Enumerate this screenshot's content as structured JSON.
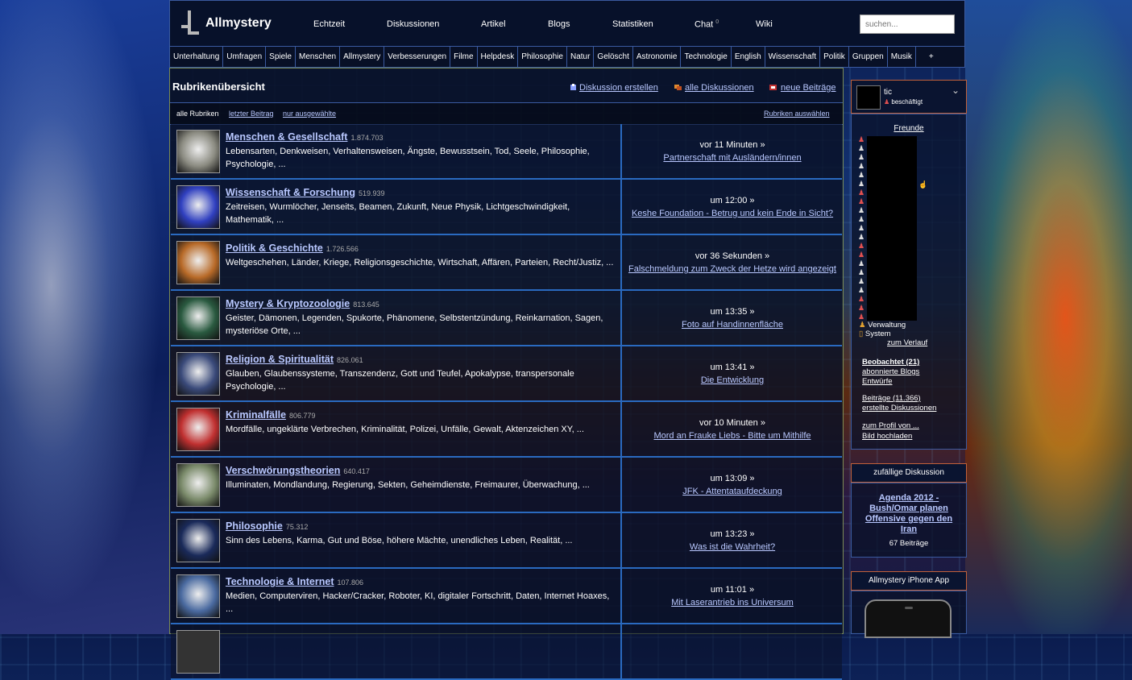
{
  "header": {
    "site_name": "Allmystery",
    "nav": [
      "Echtzeit",
      "Diskussionen",
      "Artikel",
      "Blogs",
      "Statistiken",
      "Chat",
      "Wiki"
    ],
    "chat_count": "0",
    "search_placeholder": "suchen..."
  },
  "categories": [
    "Unterhaltung",
    "Umfragen",
    "Spiele",
    "Menschen",
    "Allmystery",
    "Verbesserungen",
    "Filme",
    "Helpdesk",
    "Philosophie",
    "Natur",
    "Gelöscht",
    "Astronomie",
    "Technologie",
    "English",
    "Wissenschaft",
    "Politik",
    "Gruppen",
    "Musik",
    "+"
  ],
  "main": {
    "title": "Rubrikenübersicht",
    "actions": [
      "Diskussion erstellen",
      "alle Diskussionen",
      "neue Beiträge"
    ],
    "subnav": {
      "all": "alle Rubriken",
      "last": "letzter Beitrag",
      "selected": "nur ausgewählte",
      "choose": "Rubriken auswählen"
    },
    "rows": [
      {
        "title": "Menschen & Gesellschaft",
        "count": "1.874.703",
        "desc": "Lebensarten, Denkweisen, Verhaltensweisen, Ängste, Bewusstsein, Tod, Seele, Philosophie, Psychologie, ...",
        "time": "vor 11 Minuten »",
        "link": "Partnerschaft mit Ausländern/innen",
        "thumb": "#8a8a80"
      },
      {
        "title": "Wissenschaft & Forschung",
        "count": "519.939",
        "desc": "Zeitreisen, Wurmlöcher, Jenseits, Beamen, Zukunft, Neue Physik, Lichtgeschwindigkeit, Mathematik, ...",
        "time": "um 12:00 »",
        "link": "Keshe Foundation - Betrug und kein Ende in Sicht?",
        "thumb": "#3040c0"
      },
      {
        "title": "Politik & Geschichte",
        "count": "1.726.566",
        "desc": "Weltgeschehen, Länder, Kriege, Religionsgeschichte, Wirtschaft, Affären, Parteien, Recht/Justiz, ...",
        "time": "vor 36 Sekunden »",
        "link": "Falschmeldung zum Zweck der Hetze wird angezeigt",
        "thumb": "#b86a28"
      },
      {
        "title": "Mystery & Kryptozoologie",
        "count": "813.645",
        "desc": "Geister, Dämonen, Legenden, Spukorte, Phänomene, Selbstentzündung, Reinkarnation, Sagen, mysteriöse Orte, ...",
        "time": "um 13:35 »",
        "link": "Foto auf Handinnenfläche",
        "thumb": "#2a5a40"
      },
      {
        "title": "Religion & Spiritualität",
        "count": "826.061",
        "desc": "Glauben, Glaubenssysteme, Transzendenz, Gott und Teufel, Apokalypse, transpersonale Psychologie, ...",
        "time": "um 13:41 »",
        "link": "Die Entwicklung",
        "thumb": "#3a4a7a"
      },
      {
        "title": "Kriminalfälle",
        "count": "806.779",
        "desc": "Mordfälle, ungeklärte Verbrechen, Kriminalität, Polizei, Unfälle, Gewalt, Aktenzeichen XY, ...",
        "time": "vor 10 Minuten »",
        "link": "Mord an Frauke Liebs - Bitte um Mithilfe",
        "thumb": "#c03030"
      },
      {
        "title": "Verschwörungstheorien",
        "count": "640.417",
        "desc": "Illuminaten, Mondlandung, Regierung, Sekten, Geheimdienste, Freimaurer, Überwachung, ...",
        "time": "um 13:09 »",
        "link": "JFK - Attentataufdeckung",
        "thumb": "#7a8a6a"
      },
      {
        "title": "Philosophie",
        "count": "75.312",
        "desc": "Sinn des Lebens, Karma, Gut und Böse, höhere Mächte, unendliches Leben, Realität, ...",
        "time": "um 13:23 »",
        "link": "Was ist die Wahrheit?",
        "thumb": "#1a2a5a"
      },
      {
        "title": "Technologie & Internet",
        "count": "107.806",
        "desc": "Medien, Computerviren, Hacker/Cracker, Roboter, KI, digitaler Fortschritt, Daten, Internet Hoaxes, ...",
        "time": "um 11:01 »",
        "link": "Mit Laserantrieb ins Universum",
        "thumb": "#4a6aa0"
      }
    ]
  },
  "sidebar": {
    "username": "tic",
    "status": "beschäftigt",
    "friends_title": "Freunde",
    "friend_marks": [
      "r",
      "w",
      "w",
      "w",
      "w",
      "w",
      "r",
      "r",
      "w",
      "w",
      "w",
      "w",
      "r",
      "r",
      "w",
      "w",
      "w",
      "w",
      "r",
      "r",
      "r"
    ],
    "legend": [
      "Verwaltung",
      "System"
    ],
    "history": "zum Verlauf",
    "links1": [
      "Beobachtet (21)",
      "abonnierte Blogs",
      "Entwürfe"
    ],
    "links2": [
      "Beiträge (11.366)",
      "erstellte Diskussionen"
    ],
    "links3": [
      "zum Profil von ...",
      "Bild hochladen"
    ],
    "random_head": "zufällige Diskussion",
    "random_title": "Agenda 2012 - Bush/Omar planen Offensive gegen den Iran",
    "random_count": "67 Beiträge",
    "app_head": "Allmystery iPhone App"
  },
  "colors": {
    "accent_link": "#b9c8ff",
    "border_blue": "#2a6ac0",
    "border_orange": "#c0603a"
  }
}
